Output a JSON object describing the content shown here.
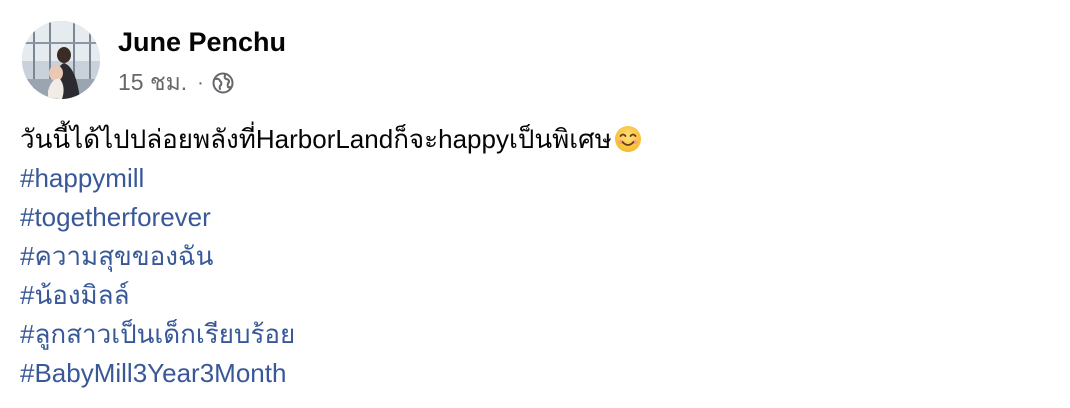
{
  "post": {
    "author": "June Penchu",
    "time": "15 ชม.",
    "separator": "·",
    "privacy_icon": "globe-icon",
    "caption": "วันนี้ได้ไปปล่อยพลังที่HarborLandก็จะhappyเป็นพิเศษ",
    "caption_emoji": "smiling-face-icon",
    "hashtags": [
      "#happymill",
      "#togetherforever",
      "#ความสุขของฉัน",
      "#น้องมิลล์",
      "#ลูกสาวเป็นเด็กเรียบร้อย",
      "#BabyMill3Year3Month"
    ]
  },
  "colors": {
    "author": "#050505",
    "meta": "#65676b",
    "hashtag": "#385898",
    "background": "#ffffff"
  }
}
